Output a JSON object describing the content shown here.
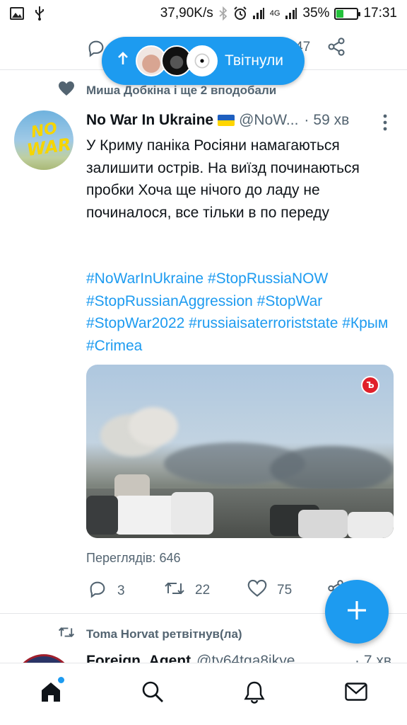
{
  "status_bar": {
    "speed": "37,90K/s",
    "network_type": "4G",
    "battery_percent": "35%",
    "battery_level": 0.35,
    "time": "17:31",
    "icons": [
      "image-icon",
      "usb-icon",
      "bluetooth-icon",
      "alarm-icon",
      "signal-icon",
      "signal-icon",
      "battery-icon"
    ]
  },
  "prev_tweet": {
    "share_count_partial": "47"
  },
  "retweeted_pill": {
    "label": "Твітнули"
  },
  "tweet": {
    "social_context": "Миша Добкіна і ще 2 вподобали",
    "author_name": "No War In Ukraine",
    "handle": "@NoW...",
    "time_sep": "·",
    "time": "59 хв",
    "text": "У Криму паніка Росіяни намагаються залишити острів. На виїзд починаються пробки Хоча ще нічого до ладу не починалося, все тільки в по переду",
    "hashtags": "#NoWarInUkraine #StopRussiaNOW #StopRussianAggression #StopWar #StopWar2022 #russiaisaterroriststate #Крым #Crimea",
    "avatar_text_top": "NO",
    "avatar_text_bottom": "WAR",
    "media_badge": "Ъ",
    "views": "Переглядів: 646",
    "reply_count": "3",
    "retweet_count": "22",
    "like_count": "75"
  },
  "next_tweet": {
    "retweeted_by": "Toma Horvat ретвітнув(ла)",
    "author_name": "Foreign_Agent",
    "handle": "@ty64tga8ikye",
    "time": "· 7 хв"
  },
  "bottom_nav": {
    "items": [
      "home-icon",
      "search-icon",
      "notifications-icon",
      "messages-icon"
    ],
    "active": "home-icon"
  },
  "colors": {
    "accent": "#1d9bf0",
    "text": "#0f1419",
    "secondary": "#536471",
    "battery": "#23c13b"
  }
}
